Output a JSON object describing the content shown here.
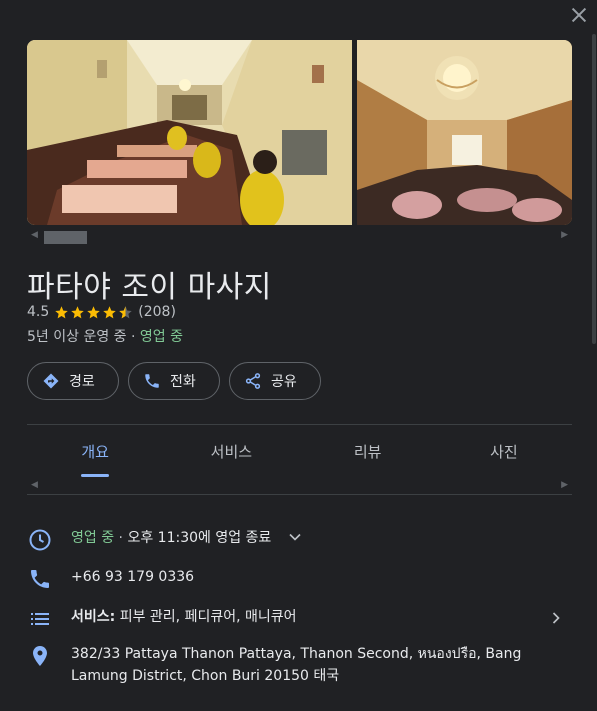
{
  "place": {
    "name": "파타야 조이 마사지",
    "rating": "4.5",
    "stars": 4.5,
    "review_count": "(208)",
    "years": "5년 이상 운영 중",
    "separator": "·",
    "status": "영업 중"
  },
  "actions": [
    {
      "label": "경로",
      "icon": "directions-icon"
    },
    {
      "label": "전화",
      "icon": "phone-icon"
    },
    {
      "label": "공유",
      "icon": "share-icon"
    }
  ],
  "tabs": [
    {
      "label": "개요",
      "active": true
    },
    {
      "label": "서비스",
      "active": false
    },
    {
      "label": "리뷰",
      "active": false
    },
    {
      "label": "사진",
      "active": false
    }
  ],
  "info": {
    "hours": {
      "status": "영업 중",
      "sep": " · ",
      "detail": "오후 11:30에 영업 종료"
    },
    "phone": "+66 93 179 0336",
    "services": {
      "label": "서비스:",
      "value": " 피부 관리, 페디큐어, 매니큐어"
    },
    "address_line1": "382/33 Pattaya Thanon Pattaya, Thanon Second, หนองปรือ, Bang",
    "address_line2": "Lamung District, Chon Buri 20150 태국"
  },
  "colors": {
    "background": "#202124",
    "accent_blue": "#8ab4f8",
    "open_green": "#81c995",
    "star_yellow": "#fbbc04"
  }
}
